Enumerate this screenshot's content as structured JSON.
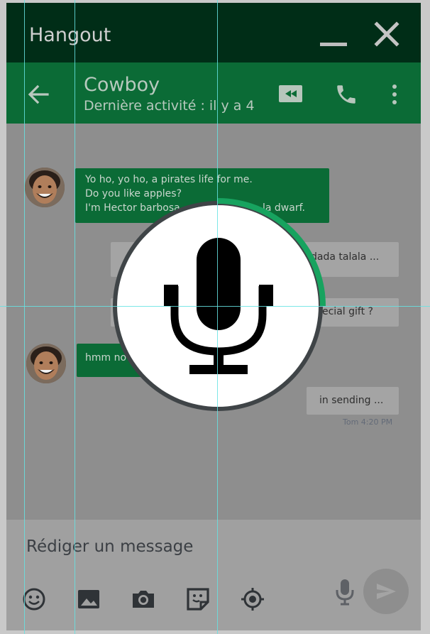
{
  "window": {
    "app_title": "Hangout"
  },
  "chat_header": {
    "contact_name": "Cowboy",
    "contact_status": "Dernière activité  : il y a 4"
  },
  "messages": [
    {
      "direction": "in",
      "lines": [
        "Yo ho, yo ho, a pirates life for me.",
        "Do you like apples?",
        "I'm Hector barbosa",
        "la dwarf."
      ]
    },
    {
      "direction": "out",
      "text": "dada talala ..."
    },
    {
      "direction": "out",
      "text": "ecial gift ?"
    },
    {
      "direction": "in",
      "text": "hmm no"
    },
    {
      "direction": "out",
      "text": "in sending ...",
      "time": "Tom 4:20 PM"
    }
  ],
  "composer": {
    "placeholder": "Rédiger un message"
  },
  "icons": {
    "minimize": "minimize-icon",
    "close": "close-icon",
    "back": "arrow-left-icon",
    "video": "video-camera-icon",
    "phone": "phone-icon",
    "more": "more-vert-icon",
    "emoji": "emoji-icon",
    "image": "image-icon",
    "camera": "camera-icon",
    "sticker": "sticker-icon",
    "location": "location-icon",
    "mic": "microphone-icon",
    "send": "send-icon"
  },
  "colors": {
    "title_bar": "#002d17",
    "chat_bar": "#0b6b36",
    "incoming_bubble": "#0b6b36",
    "outgoing_bubble": "#a4a4a4",
    "record_progress": "#17a35f"
  },
  "recording": {
    "progress": 0.25
  }
}
